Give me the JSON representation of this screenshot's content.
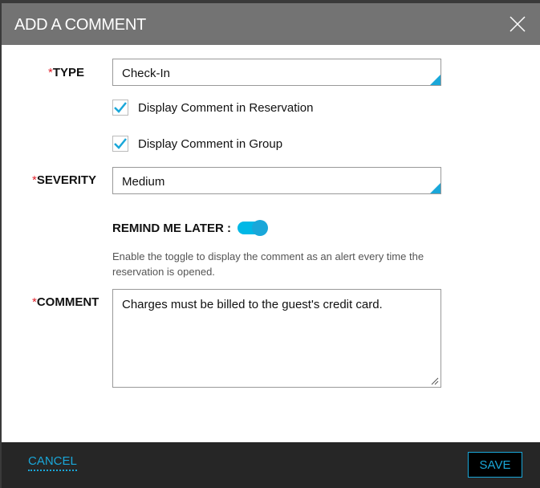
{
  "dialog": {
    "title": "ADD A COMMENT",
    "close_icon": "close-icon"
  },
  "form": {
    "required_marker": "*",
    "type": {
      "label": "TYPE",
      "value": "Check-In"
    },
    "display_in_reservation": {
      "label": "Display Comment in Reservation",
      "checked": true
    },
    "display_in_group": {
      "label": "Display Comment in Group",
      "checked": true
    },
    "severity": {
      "label": "SEVERITY",
      "value": "Medium"
    },
    "remind": {
      "label": "REMIND ME LATER :",
      "on": true,
      "help": "Enable the toggle to display the comment as an alert every time the reservation is opened."
    },
    "comment": {
      "label": "COMMENT",
      "value": "Charges must be billed to the guest's credit card."
    }
  },
  "footer": {
    "cancel": "CANCEL",
    "save": "SAVE"
  },
  "colors": {
    "accent": "#1aa7d9",
    "header": "#737373",
    "footer": "#262626",
    "required": "#e0202a"
  }
}
